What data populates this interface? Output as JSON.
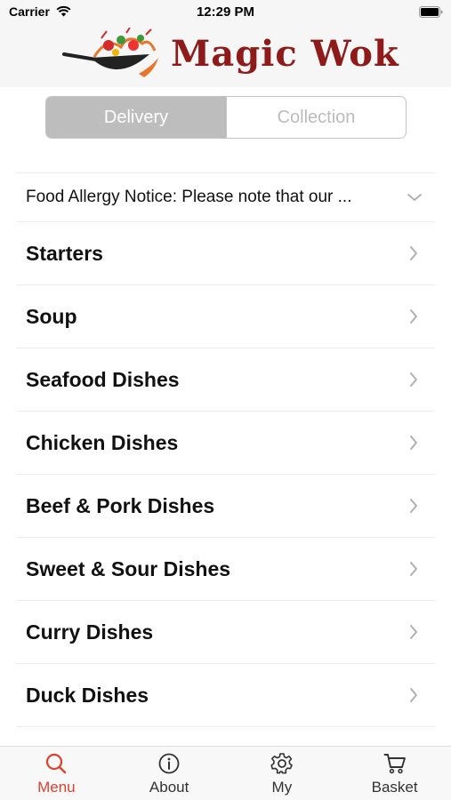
{
  "status_bar": {
    "carrier": "Carrier",
    "time": "12:29 PM"
  },
  "header": {
    "logo_text": "Magic Wok"
  },
  "order_type": {
    "options": [
      "Delivery",
      "Collection"
    ],
    "selected": "Delivery"
  },
  "notice": {
    "text": "Food Allergy Notice: Please note that our ..."
  },
  "categories": [
    {
      "label": "Starters"
    },
    {
      "label": "Soup"
    },
    {
      "label": "Seafood Dishes"
    },
    {
      "label": "Chicken Dishes"
    },
    {
      "label": "Beef & Pork Dishes"
    },
    {
      "label": "Sweet & Sour Dishes"
    },
    {
      "label": "Curry Dishes"
    },
    {
      "label": "Duck Dishes"
    }
  ],
  "tab_bar": {
    "items": [
      {
        "label": "Menu",
        "icon": "search-icon",
        "active": true
      },
      {
        "label": "About",
        "icon": "info-icon",
        "active": false
      },
      {
        "label": "My",
        "icon": "gear-icon",
        "active": false
      },
      {
        "label": "Basket",
        "icon": "cart-icon",
        "active": false
      }
    ]
  },
  "colors": {
    "accent": "#e0402e",
    "brand": "#8e1a1a",
    "segment_selected": "#bdbdbd"
  }
}
